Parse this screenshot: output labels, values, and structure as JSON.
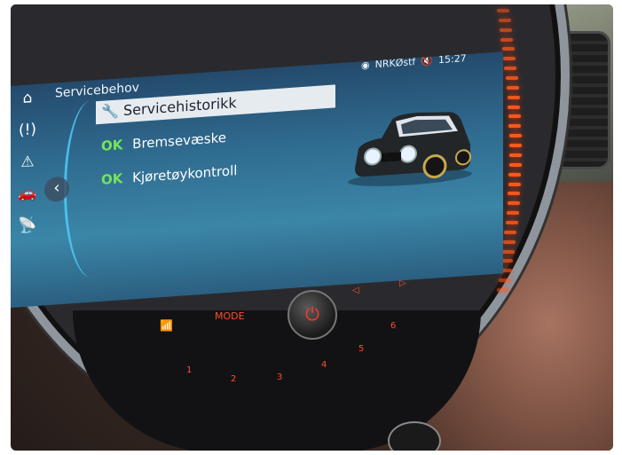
{
  "header": {
    "title": "Servicebehov",
    "radio_station": "NRKØstf",
    "time": "15:27",
    "radio_icon": "radio-icon",
    "mute_icon": "mute-icon"
  },
  "sidebar": {
    "icons": [
      "home-icon",
      "tire-pressure-icon",
      "warning-icon",
      "car-service-icon",
      "connectivity-icon"
    ],
    "back_icon": "chevron-left-icon"
  },
  "menu": {
    "items": [
      {
        "status": "",
        "label": "Servicehistorikk",
        "icon": "service-history-icon",
        "selected": true
      },
      {
        "status": "OK",
        "label": "Bremsevæske",
        "selected": false
      },
      {
        "status": "OK",
        "label": "Kjøretøykontroll",
        "selected": false
      }
    ]
  },
  "controls": {
    "mode_label": "MODE",
    "presets": [
      "1",
      "2",
      "3",
      "4",
      "5",
      "6"
    ],
    "power_icon": "power-icon"
  },
  "colors": {
    "screen_bg": "#2f6b8f",
    "ok_green": "#77e35a",
    "led_orange": "#ff5a1a",
    "button_red": "#ff4d2e"
  }
}
